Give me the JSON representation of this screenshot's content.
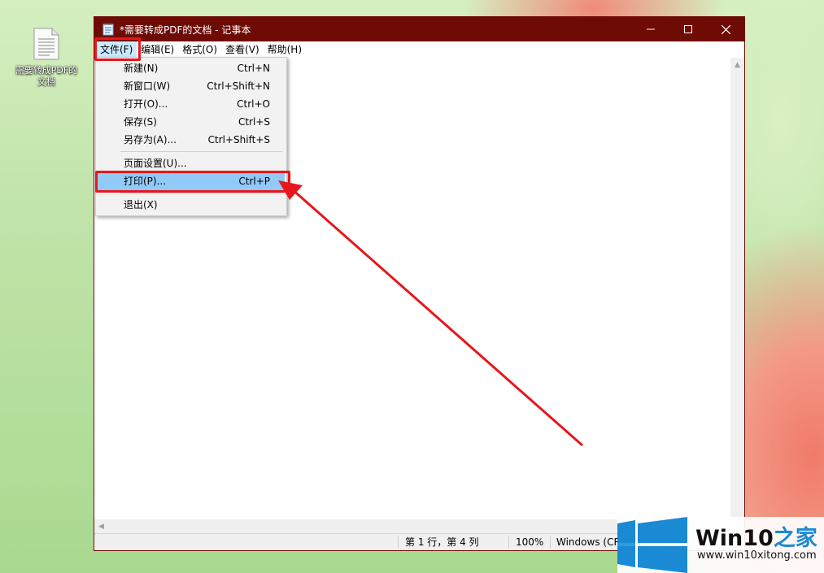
{
  "desktop": {
    "icon_label": "需要转成PDF的文档"
  },
  "window": {
    "title": "*需要转成PDF的文档 - 记事本",
    "controls": {
      "minimize": "—",
      "maximize": "☐",
      "close": "✕"
    }
  },
  "menubar": [
    {
      "label": "文件(F)"
    },
    {
      "label": "编辑(E)"
    },
    {
      "label": "格式(O)"
    },
    {
      "label": "查看(V)"
    },
    {
      "label": "帮助(H)"
    }
  ],
  "file_menu": [
    {
      "label": "新建(N)",
      "shortcut": "Ctrl+N"
    },
    {
      "label": "新窗口(W)",
      "shortcut": "Ctrl+Shift+N"
    },
    {
      "label": "打开(O)...",
      "shortcut": "Ctrl+O"
    },
    {
      "label": "保存(S)",
      "shortcut": "Ctrl+S"
    },
    {
      "label": "另存为(A)...",
      "shortcut": "Ctrl+Shift+S"
    },
    {
      "label": "页面设置(U)...",
      "shortcut": ""
    },
    {
      "label": "打印(P)...",
      "shortcut": "Ctrl+P"
    },
    {
      "label": "退出(X)",
      "shortcut": ""
    }
  ],
  "statusbar": {
    "position": "第 1 行，第 4 列",
    "zoom": "100%",
    "encoding": "Windows (CRLF)"
  },
  "watermark": {
    "brand": "Win10",
    "brand_zh": "之家",
    "url": "www.win10xitong.com"
  },
  "colors": {
    "titlebar": "#6e0b05",
    "highlight": "#e8161b",
    "menu_hover": "#91c9f7"
  }
}
